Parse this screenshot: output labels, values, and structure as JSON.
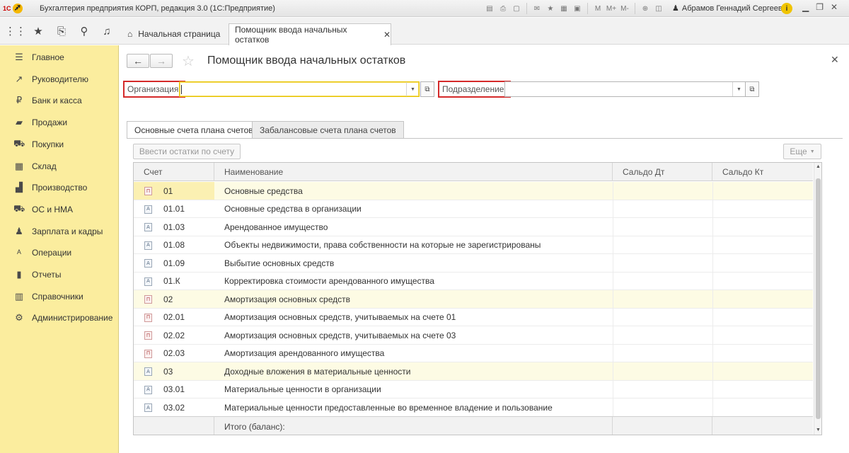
{
  "window": {
    "app_title": "Бухгалтерия предприятия КОРП, редакция 3.0  (1С:Предприятие)",
    "logo_text": "1С",
    "user_name": "Абрамов Геннадий Сергеевич",
    "toolbar_icons": [
      "save-icon",
      "print-icon",
      "preview-icon",
      "mail-icon",
      "favorites-icon",
      "calculator-icon",
      "calendar-icon",
      "m-icon",
      "m-plus-icon",
      "m-minus-icon",
      "zoom-icon",
      "panel-icon"
    ]
  },
  "top_panel": {
    "home_tab_label": "Начальная страница",
    "active_tab_label": "Помощник ввода начальных остатков"
  },
  "sidebar": {
    "items": [
      {
        "label": "Главное",
        "icon": "menu-icon"
      },
      {
        "label": "Руководителю",
        "icon": "chart-line-icon"
      },
      {
        "label": "Банк и касса",
        "icon": "ruble-icon"
      },
      {
        "label": "Продажи",
        "icon": "shopping-bag-icon"
      },
      {
        "label": "Покупки",
        "icon": "cart-icon"
      },
      {
        "label": "Склад",
        "icon": "warehouse-icon"
      },
      {
        "label": "Производство",
        "icon": "factory-icon"
      },
      {
        "label": "ОС и НМА",
        "icon": "truck-icon"
      },
      {
        "label": "Зарплата и кадры",
        "icon": "people-icon"
      },
      {
        "label": "Операции",
        "icon": "operations-icon"
      },
      {
        "label": "Отчеты",
        "icon": "bar-chart-icon"
      },
      {
        "label": "Справочники",
        "icon": "book-icon"
      },
      {
        "label": "Администрирование",
        "icon": "gear-icon"
      }
    ]
  },
  "form": {
    "title": "Помощник ввода начальных остатков",
    "organization_label": "Организация:",
    "organization_value": "",
    "department_label": "Подразделение:",
    "department_value": "",
    "tabs": [
      {
        "label": "Основные счета плана счетов",
        "active": true
      },
      {
        "label": "Забалансовые счета плана счетов",
        "active": false
      }
    ],
    "enter_balance_button": "Ввести остатки по счету",
    "more_button": "Еще"
  },
  "table": {
    "columns": [
      "Счет",
      "Наименование",
      "Сальдо Дт",
      "Сальдо Кт"
    ],
    "rows": [
      {
        "account": "01",
        "name": "Основные средства",
        "group": true,
        "icon": "red-no"
      },
      {
        "account": "01.01",
        "name": "Основные средства в организации",
        "group": false,
        "icon": "blue"
      },
      {
        "account": "01.03",
        "name": "Арендованное имущество",
        "group": false,
        "icon": "blue"
      },
      {
        "account": "01.08",
        "name": "Объекты недвижимости, права собственности на которые не зарегистрированы",
        "group": false,
        "icon": "blue"
      },
      {
        "account": "01.09",
        "name": "Выбытие основных средств",
        "group": false,
        "icon": "blue"
      },
      {
        "account": "01.К",
        "name": "Корректировка стоимости арендованного имущества",
        "group": false,
        "icon": "blue"
      },
      {
        "account": "02",
        "name": "Амортизация основных средств",
        "group": true,
        "icon": "red"
      },
      {
        "account": "02.01",
        "name": "Амортизация основных средств, учитываемых на счете 01",
        "group": false,
        "icon": "red"
      },
      {
        "account": "02.02",
        "name": "Амортизация основных средств, учитываемых на счете 03",
        "group": false,
        "icon": "red"
      },
      {
        "account": "02.03",
        "name": "Амортизация арендованного имущества",
        "group": false,
        "icon": "red"
      },
      {
        "account": "03",
        "name": "Доходные вложения в материальные ценности",
        "group": true,
        "icon": "blue"
      },
      {
        "account": "03.01",
        "name": "Материальные ценности в организации",
        "group": false,
        "icon": "blue"
      },
      {
        "account": "03.02",
        "name": "Материальные ценности предоставленные во временное владение и пользование",
        "group": false,
        "icon": "blue"
      }
    ],
    "footer_label": "Итого (баланс):"
  }
}
